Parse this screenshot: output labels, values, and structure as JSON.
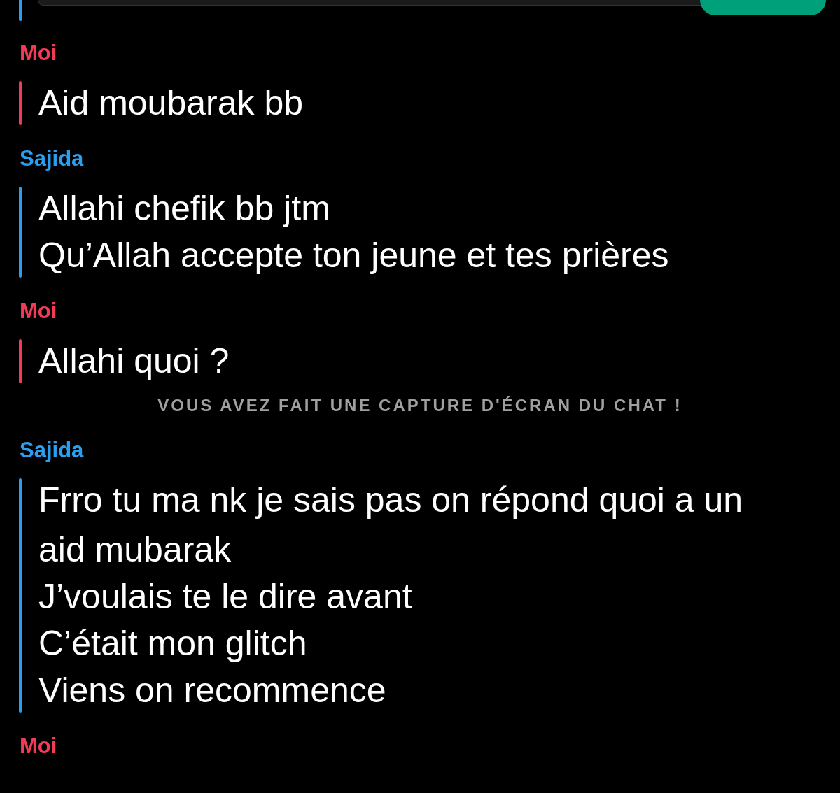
{
  "items": [
    {
      "kind": "group",
      "sender": "Moi",
      "color": "#f23c57",
      "messages": [
        "Aid moubarak bb"
      ]
    },
    {
      "kind": "group",
      "sender": "Sajida",
      "color": "#2a9ff0",
      "messages": [
        "Allahi chefik bb jtm",
        "Qu’Allah accepte ton jeune et tes prières"
      ]
    },
    {
      "kind": "group",
      "sender": "Moi",
      "color": "#f23c57",
      "messages": [
        "Allahi quoi ?"
      ]
    },
    {
      "kind": "notice",
      "text": "VOUS AVEZ FAIT UNE CAPTURE D'ÉCRAN DU CHAT !"
    },
    {
      "kind": "group",
      "sender": "Sajida",
      "color": "#2a9ff0",
      "messages": [
        "Frro tu ma nk je sais pas on répond quoi a un aid mubarak",
        "J’voulais te le dire avant",
        "C’était mon glitch",
        "Viens on recommence"
      ]
    },
    {
      "kind": "group",
      "sender": "Moi",
      "color": "#f23c57"
    }
  ]
}
